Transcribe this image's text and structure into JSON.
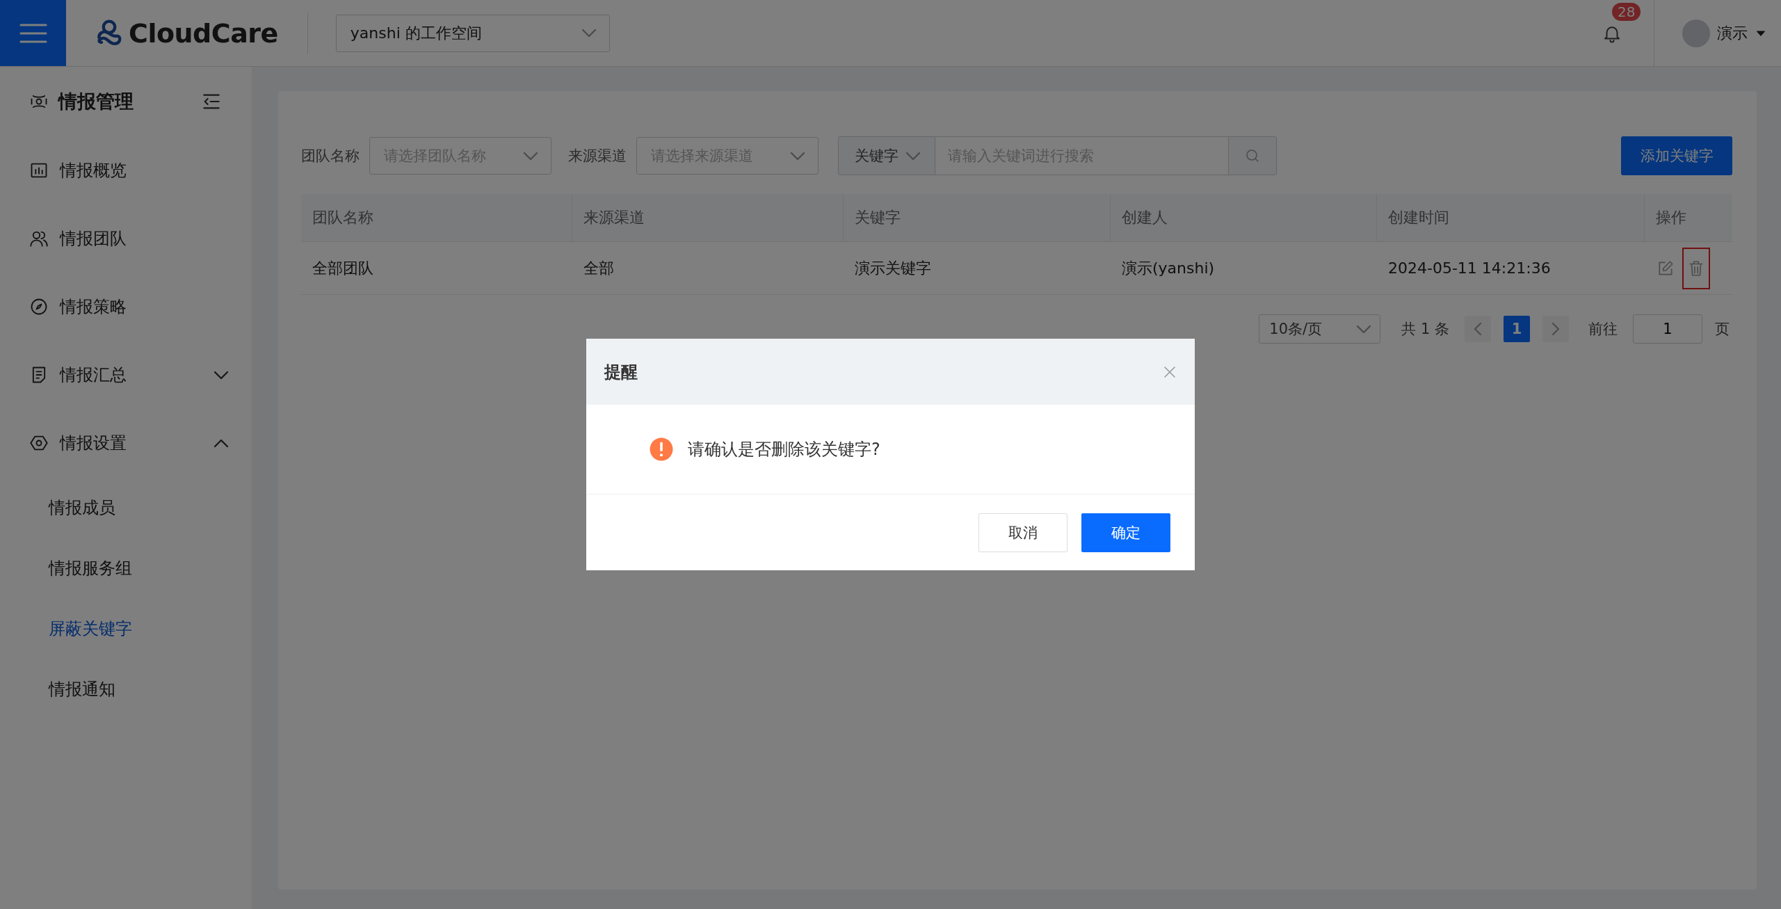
{
  "header": {
    "logo": "CloudCare",
    "workspace": "yanshi 的工作空间",
    "notifications": "28",
    "user": "演示"
  },
  "sidebar": {
    "title": "情报管理",
    "items": [
      {
        "kind": "link",
        "label": "情报概览",
        "selected": false
      },
      {
        "kind": "link",
        "label": "情报团队",
        "selected": false
      },
      {
        "kind": "link",
        "label": "情报策略",
        "selected": false
      },
      {
        "kind": "group",
        "label": "情报汇总",
        "expanded": false
      },
      {
        "kind": "group",
        "label": "情报设置",
        "expanded": true,
        "children": [
          {
            "label": "情报成员",
            "selected": false
          },
          {
            "label": "情报服务组",
            "selected": false
          },
          {
            "label": "屏蔽关键字",
            "selected": true
          },
          {
            "label": "情报通知",
            "selected": false
          }
        ]
      }
    ]
  },
  "filters": {
    "team_label": "团队名称",
    "team_placeholder": "请选择团队名称",
    "source_label": "来源渠道",
    "source_placeholder": "请选择来源渠道",
    "keyword_type": "关键字",
    "keyword_placeholder": "请输入关键词进行搜索",
    "add_button": "添加关键字"
  },
  "table": {
    "columns": [
      "团队名称",
      "来源渠道",
      "关键字",
      "创建人",
      "创建时间",
      "操作"
    ],
    "rows": [
      {
        "cells": [
          "全部团队",
          "全部",
          "演示关键字",
          "演示(yanshi)",
          "2024-05-11 14:21:36"
        ],
        "delete_highlighted": true
      }
    ]
  },
  "pagination": {
    "page_size": "10条/页",
    "total": "共 1 条",
    "pages": [
      {
        "label": "1",
        "selected": true
      }
    ],
    "goto_label": "前往",
    "goto_value": "1",
    "goto_suffix": "页"
  },
  "dialog": {
    "title": "提醒",
    "message": "请确认是否删除该关键字?",
    "cancel": "取消",
    "confirm": "确定"
  }
}
